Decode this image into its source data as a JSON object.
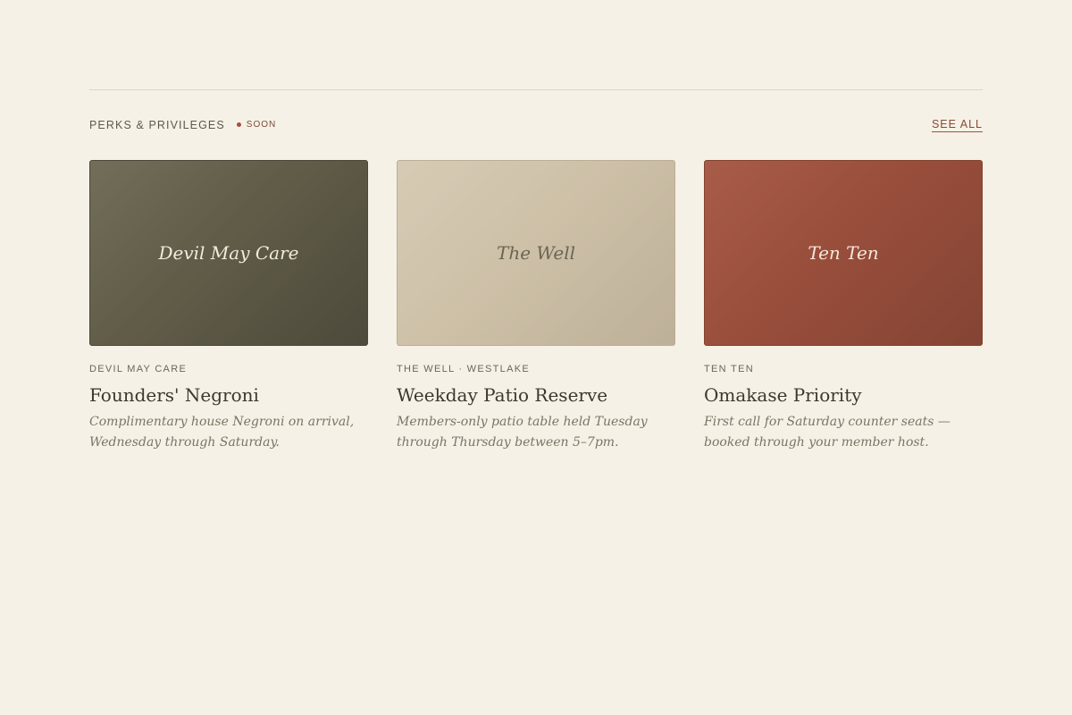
{
  "section": {
    "title": "PERKS & PRIVILEGES",
    "status_label": "SOON",
    "see_all_label": "SEE ALL"
  },
  "colors": {
    "background": "#f6f1e6",
    "accent": "#a2503c",
    "olive": "#5f5b47",
    "sand": "#cdc0a7",
    "terracotta": "#984d3b"
  },
  "cards": [
    {
      "venue_mark": "Devil May Care",
      "eyebrow": "DEVIL MAY CARE",
      "title": "Founders' Negroni",
      "description": "Complimentary house Negroni on arrival, Wednesday through Saturday."
    },
    {
      "venue_mark": "The Well",
      "eyebrow": "THE WELL · WESTLAKE",
      "title": "Weekday Patio Reserve",
      "description": "Members-only patio table held Tuesday through Thursday between 5–7pm."
    },
    {
      "venue_mark": "Ten Ten",
      "eyebrow": "TEN TEN",
      "title": "Omakase Priority",
      "description": "First call for Saturday counter seats — booked through your member host."
    }
  ]
}
